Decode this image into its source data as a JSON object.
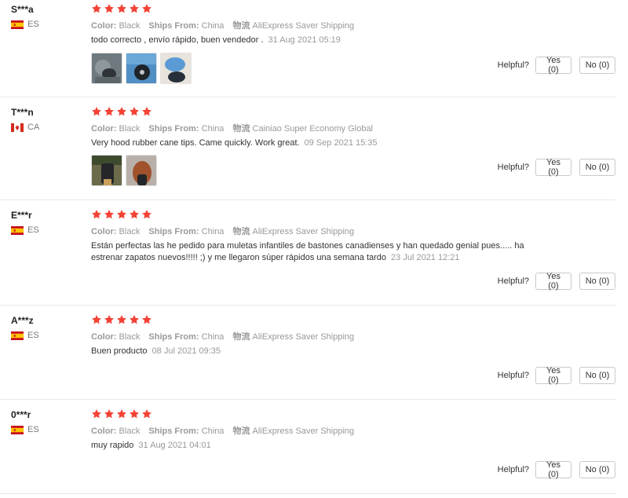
{
  "colors": {
    "star": "#f44336",
    "separator": "#e8e8e8",
    "muted": "#999999"
  },
  "labels": {
    "color": "Color:",
    "ships_from": "Ships From:",
    "helpful": "Helpful?"
  },
  "reviews": [
    {
      "user": "S***a",
      "country": "ES",
      "flag": "es-flag-icon",
      "rating": 5,
      "color": "Black",
      "ships_from": "China",
      "shipping_label": "物流",
      "shipping": "AliExpress Saver Shipping",
      "text": "todo correcto , envío rápido, buen vendedor .",
      "date": "31 Aug 2021 05:19",
      "yes": "Yes (0)",
      "no": "No (0)",
      "photos": [
        "photo-cane-tips-1",
        "photo-cane-tips-2",
        "photo-cane-tips-3"
      ]
    },
    {
      "user": "T***n",
      "country": "CA",
      "flag": "ca-flag-icon",
      "rating": 5,
      "color": "Black",
      "ships_from": "China",
      "shipping_label": "物流",
      "shipping": "Cainiao Super Economy Global",
      "text": "Very hood rubber cane tips. Came quickly. Work great.",
      "date": "09 Sep 2021 15:35",
      "yes": "Yes (0)",
      "no": "No (0)",
      "photos": [
        "photo-cane-tip-4",
        "photo-cane-tip-5"
      ]
    },
    {
      "user": "E***r",
      "country": "ES",
      "flag": "es-flag-icon",
      "rating": 5,
      "color": "Black",
      "ships_from": "China",
      "shipping_label": "物流",
      "shipping": "AliExpress Saver Shipping",
      "text": "Están perfectas las he pedido para muletas infantiles de bastones canadienses y han quedado genial pues..... ha estrenar zapatos nuevos!!!!! ;) y me llegaron súper rápidos una semana tardo",
      "date": "23 Jul 2021 12:21",
      "yes": "Yes (0)",
      "no": "No (0)",
      "photos": []
    },
    {
      "user": "A***z",
      "country": "ES",
      "flag": "es-flag-icon",
      "rating": 5,
      "color": "Black",
      "ships_from": "China",
      "shipping_label": "物流",
      "shipping": "AliExpress Saver Shipping",
      "text": "Buen producto",
      "date": "08 Jul 2021 09:35",
      "yes": "Yes (0)",
      "no": "No (0)",
      "photos": []
    },
    {
      "user": "0***r",
      "country": "ES",
      "flag": "es-flag-icon",
      "rating": 5,
      "color": "Black",
      "ships_from": "China",
      "shipping_label": "物流",
      "shipping": "AliExpress Saver Shipping",
      "text": "muy rapido",
      "date": "31 Aug 2021 04:01",
      "yes": "Yes (0)",
      "no": "No (0)",
      "photos": []
    }
  ]
}
